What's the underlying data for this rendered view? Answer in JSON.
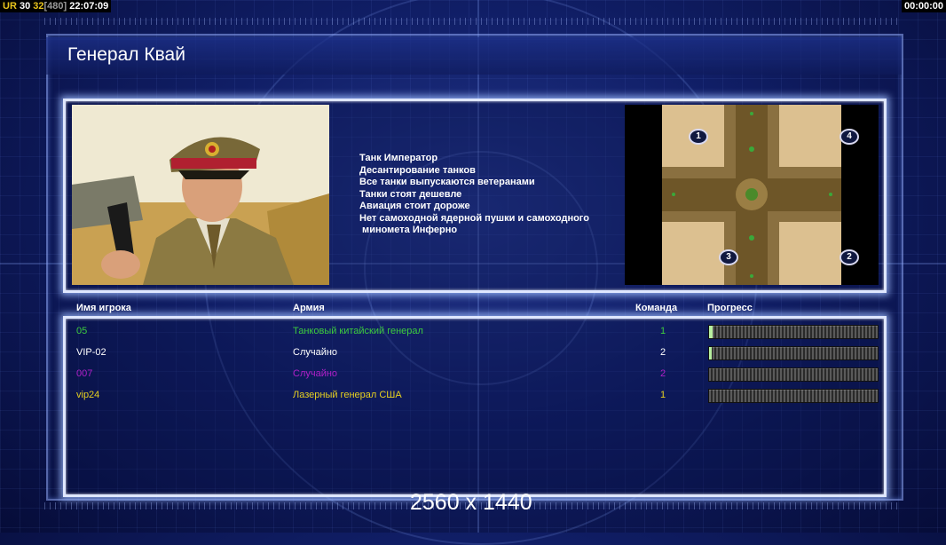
{
  "hud": {
    "left": [
      {
        "text": "UR",
        "color": "y"
      },
      {
        "text": " 30 ",
        "color": "w"
      },
      {
        "text": "32",
        "color": "y"
      },
      {
        "text": "[480]",
        "color": "g"
      },
      {
        "text": " 22:07:09",
        "color": "w"
      }
    ],
    "right": "00:00:00"
  },
  "title": "Генерал Квай",
  "features": [
    "Танк Император",
    "Десантирование танков",
    "Все танки выпускаются ветеранами",
    "Танки стоят дешевле",
    "Авиация стоит дороже",
    "Нет самоходной ядерной пушки и самоходного",
    " минометa Инферно"
  ],
  "map": {
    "spawns": [
      {
        "label": "1"
      },
      {
        "label": "4"
      },
      {
        "label": "3"
      },
      {
        "label": "2"
      }
    ]
  },
  "table": {
    "headers": {
      "player": "Имя игрока",
      "army": "Армия",
      "team": "Команда",
      "progress": "Прогресс"
    },
    "rows": [
      {
        "player": "05",
        "army": "Танковый китайский генерал",
        "team": "1",
        "color": "#3dcc3d",
        "progress": 0.02
      },
      {
        "player": "VIP-02",
        "army": "Случайно",
        "team": "2",
        "color": "#ffffff",
        "progress": 0.01
      },
      {
        "player": "007",
        "army": "Случайно",
        "team": "2",
        "color": "#b020c8",
        "progress": 0.0
      },
      {
        "player": "vip24",
        "army": "Лазерный генерал США",
        "team": "1",
        "color": "#e6d020",
        "progress": 0.0
      }
    ]
  },
  "resolution": "2560 x 1440"
}
